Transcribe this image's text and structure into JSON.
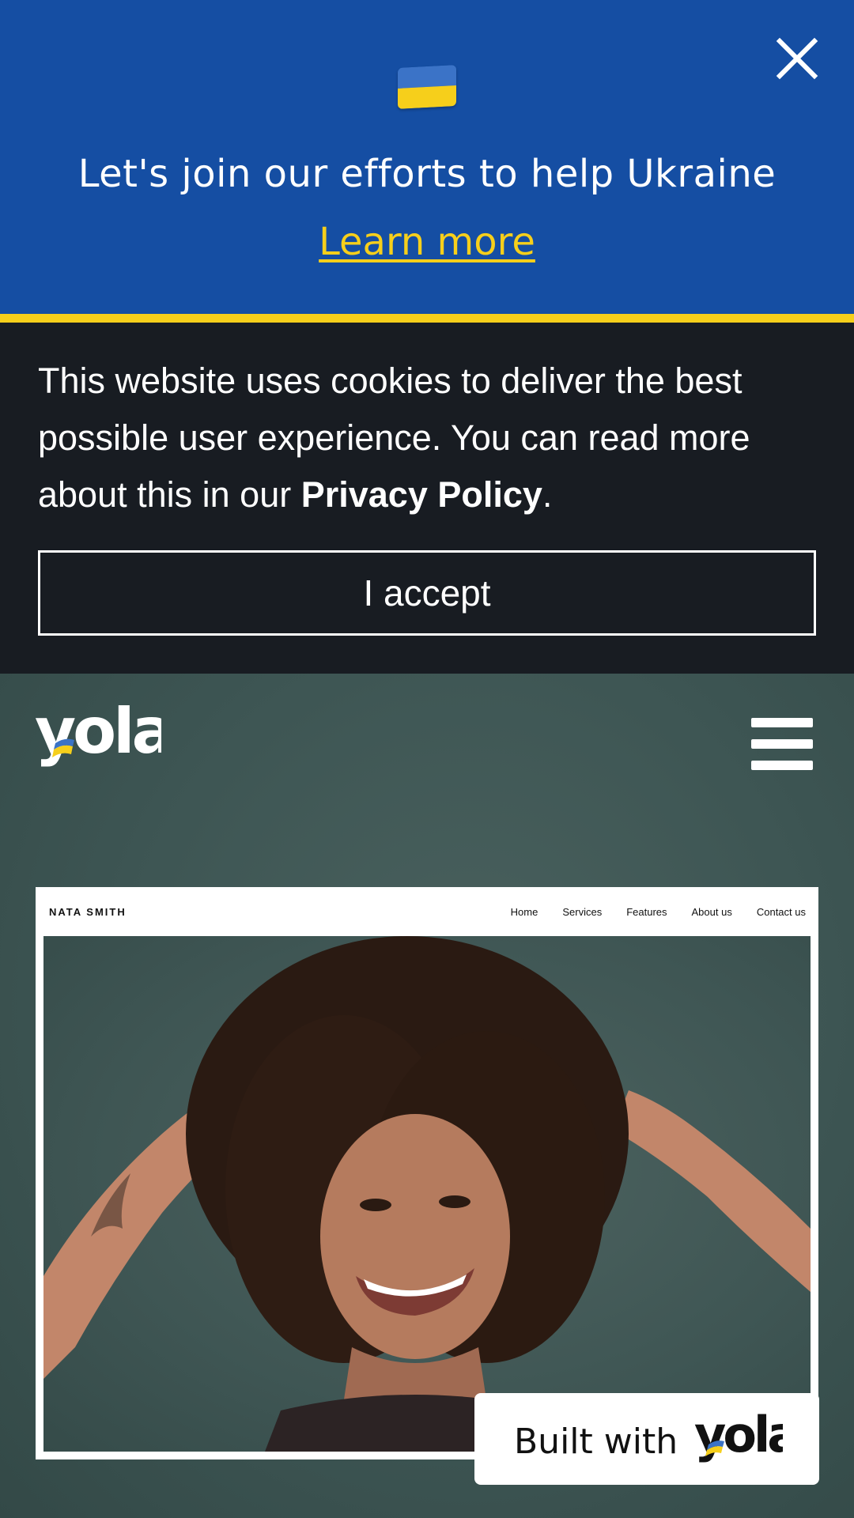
{
  "ua_banner": {
    "flag_icon": "ukraine-flag-icon",
    "message": "Let's join our efforts to help Ukraine",
    "link_label": "Learn more",
    "close_icon": "close-icon",
    "colors": {
      "background": "#154ea3",
      "accent": "#f6cf1b"
    }
  },
  "cookie_banner": {
    "text_prefix": "This website uses cookies to deliver the best possible user experience. You can read more about this in our ",
    "policy_link": "Privacy Policy",
    "text_suffix": ".",
    "accept_label": "I accept",
    "colors": {
      "background": "#181c22"
    }
  },
  "header": {
    "logo_text": "yola",
    "menu_icon": "hamburger-menu-icon"
  },
  "preview": {
    "brand": "NATA SMITH",
    "nav": [
      "Home",
      "Services",
      "Features",
      "About us",
      "Contact us"
    ],
    "image": "smiling-woman-curly-hair-photo"
  },
  "badge": {
    "label": "Built with",
    "logo_text": "yola"
  }
}
